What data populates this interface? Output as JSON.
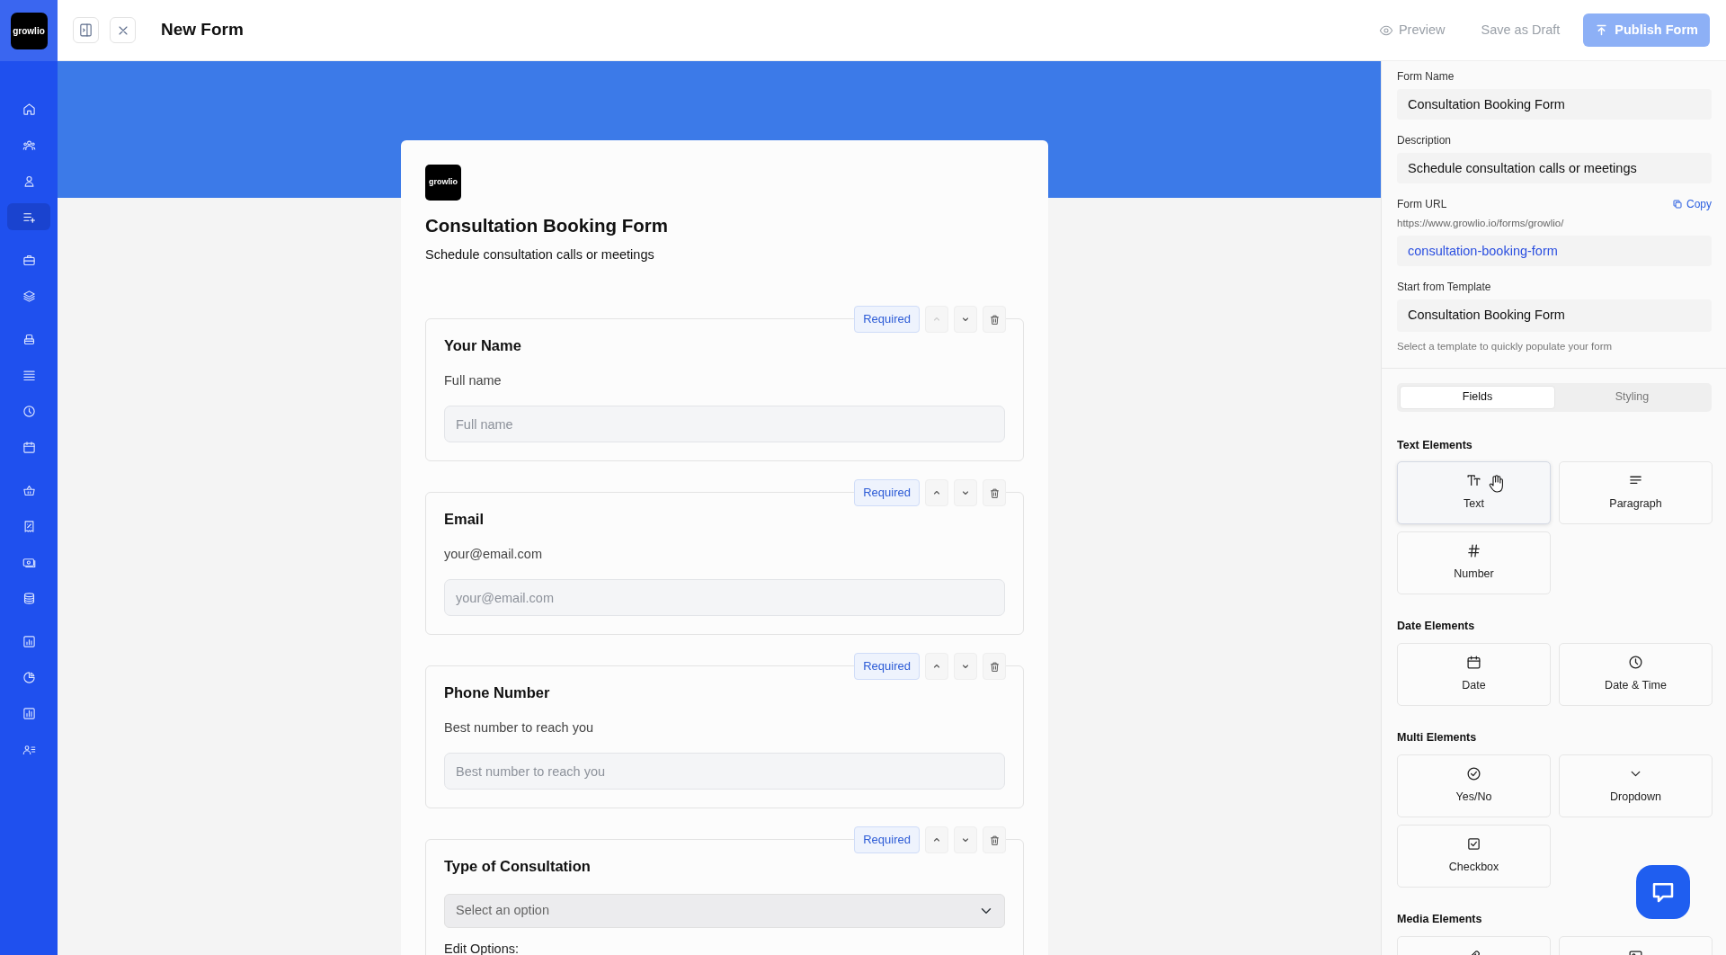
{
  "sidebar": {
    "logo": "growlio",
    "items": [
      {
        "selected": false
      },
      {
        "selected": false
      },
      {
        "selected": false
      },
      {
        "selected": true
      },
      {
        "selected": false
      },
      {
        "selected": false
      },
      {
        "selected": false
      },
      {
        "selected": false
      },
      {
        "selected": false
      },
      {
        "selected": false
      },
      {
        "selected": false
      },
      {
        "selected": false
      },
      {
        "selected": false
      },
      {
        "selected": false
      },
      {
        "selected": false
      },
      {
        "selected": false
      },
      {
        "selected": false
      },
      {
        "selected": false
      }
    ]
  },
  "header": {
    "title": "New Form",
    "actions": [
      {
        "kind": "preview",
        "label": "Preview",
        "disabled": true
      },
      {
        "kind": "draft",
        "label": "Save as Draft",
        "disabled": true
      },
      {
        "kind": "publish",
        "label": "Publish Form",
        "disabled": true
      }
    ]
  },
  "form": {
    "logo": "growlio",
    "title": "Consultation Booking Form",
    "description": "Schedule consultation calls or meetings",
    "fields": [
      {
        "kind": "text",
        "label": "Your Name",
        "help": "Full name",
        "placeholder": "Full name",
        "required": "Required",
        "up_disabled": true
      },
      {
        "kind": "text",
        "label": "Email",
        "help": "your@email.com",
        "placeholder": "your@email.com",
        "required": "Required",
        "up_disabled": false
      },
      {
        "kind": "text",
        "label": "Phone Number",
        "help": "Best number to reach you",
        "placeholder": "Best number to reach you",
        "required": "Required",
        "up_disabled": false
      },
      {
        "kind": "select",
        "label": "Type of Consultation",
        "placeholder": "Select an option",
        "options_label": "Edit Options:",
        "required": "Required",
        "up_disabled": false
      }
    ]
  },
  "settings": {
    "form_name": {
      "label": "Form Name",
      "value": "Consultation Booking Form"
    },
    "description": {
      "label": "Description",
      "value": "Schedule consultation calls or meetings"
    },
    "form_url": {
      "label": "Form URL",
      "copy": "Copy",
      "prefix": "https://www.growlio.io/forms/growlio/",
      "slug": "consultation-booking-form"
    },
    "template": {
      "label": "Start from Template",
      "value": "Consultation Booking Form",
      "hint": "Select a template to quickly populate your form"
    }
  },
  "tabs": [
    {
      "label": "Fields",
      "selected": true
    },
    {
      "label": "Styling",
      "selected": false
    }
  ],
  "palette": [
    {
      "title": "Text Elements",
      "items": [
        {
          "kind": "text",
          "label": "Text",
          "hovered": true
        },
        {
          "kind": "paragraph",
          "label": "Paragraph",
          "hovered": false
        },
        {
          "kind": "number",
          "label": "Number",
          "hovered": false
        }
      ]
    },
    {
      "title": "Date Elements",
      "items": [
        {
          "kind": "date",
          "label": "Date",
          "hovered": false
        },
        {
          "kind": "datetime",
          "label": "Date & Time",
          "hovered": false
        }
      ]
    },
    {
      "title": "Multi Elements",
      "items": [
        {
          "kind": "yesno",
          "label": "Yes/No",
          "hovered": false
        },
        {
          "kind": "dropdown",
          "label": "Dropdown",
          "hovered": false
        },
        {
          "kind": "checkbox",
          "label": "Checkbox",
          "hovered": false
        }
      ]
    },
    {
      "title": "Media Elements",
      "items": [
        {
          "kind": "attachment",
          "hovered": false
        },
        {
          "kind": "image",
          "hovered": false
        }
      ]
    }
  ]
}
